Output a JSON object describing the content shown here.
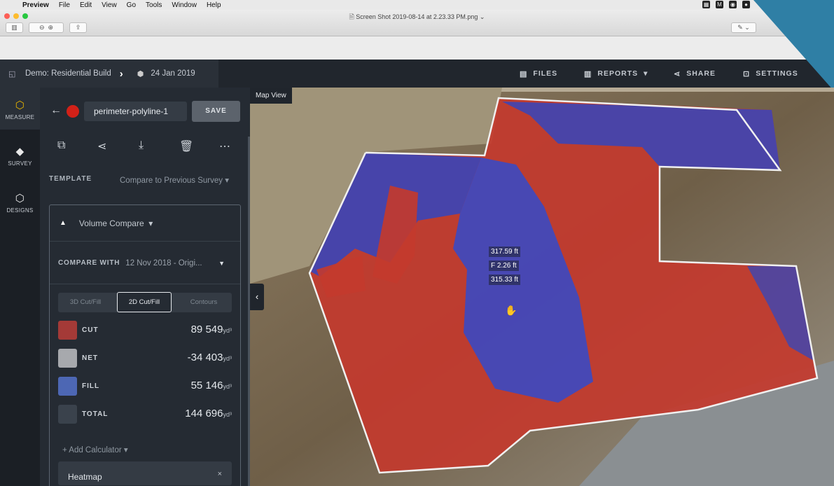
{
  "menubar": {
    "app": "Preview",
    "items": [
      "File",
      "Edit",
      "View",
      "Go",
      "Tools",
      "Window",
      "Help"
    ]
  },
  "preview_window": {
    "title": "Screen Shot 2019-08-14 at 2.23.33 PM.png"
  },
  "topbar": {
    "project": "Demo: Residential Build",
    "date": "24 Jan 2019",
    "nav": [
      {
        "label": "FILES",
        "icon": "files-icon"
      },
      {
        "label": "REPORTS",
        "icon": "reports-icon"
      },
      {
        "label": "SHARE",
        "icon": "share-icon"
      },
      {
        "label": "SETTINGS",
        "icon": "settings-icon"
      }
    ]
  },
  "rail": {
    "items": [
      {
        "label": "MEASURE",
        "icon": "measure-icon",
        "active": true
      },
      {
        "label": "SURVEY",
        "icon": "survey-layers-icon"
      },
      {
        "label": "DESIGNS",
        "icon": "designs-cube-icon"
      }
    ]
  },
  "panel": {
    "name_value": "perimeter-polyline-1",
    "save_label": "SAVE",
    "template_label": "TEMPLATE",
    "template_value": "Compare to Previous Survey",
    "calc_type": "Volume Compare",
    "compare_with_label": "COMPARE WITH",
    "compare_with_value": "12 Nov 2018 - Origi...",
    "tabs": [
      "3D Cut/Fill",
      "2D Cut/Fill",
      "Contours"
    ],
    "active_tab": 1,
    "results": [
      {
        "name": "CUT",
        "value": "89 549",
        "unit": "yd³",
        "color": "#a43a37"
      },
      {
        "name": "NET",
        "value": "-34 403",
        "unit": "yd³",
        "color": "#a7a9ad"
      },
      {
        "name": "FILL",
        "value": "55 146",
        "unit": "yd³",
        "color": "#4d67b4"
      },
      {
        "name": "TOTAL",
        "value": "144 696",
        "unit": "yd³",
        "color": "#3a424c"
      }
    ],
    "add_calculator": "+ Add Calculator",
    "heatmap_label": "Heatmap"
  },
  "map": {
    "label": "Map View",
    "readouts": [
      "317.59 ft",
      "F 2.26 ft",
      "315.33 ft"
    ]
  }
}
